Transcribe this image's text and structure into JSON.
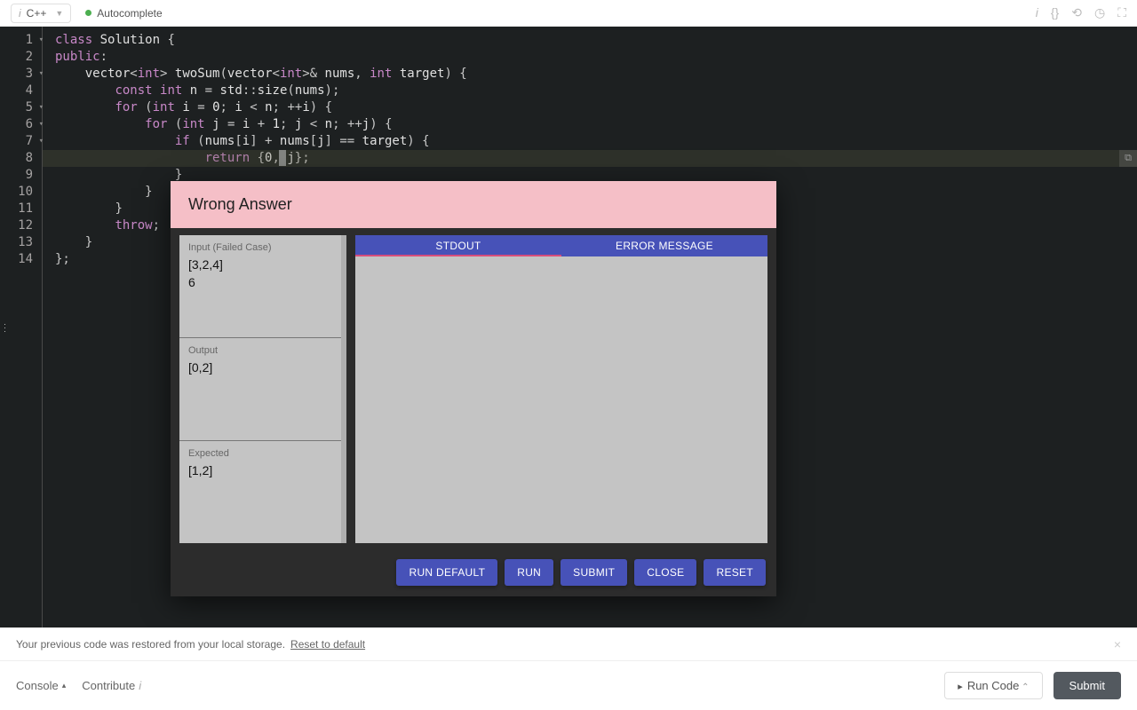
{
  "toolbar": {
    "language": "C++",
    "autocomplete": "Autocomplete"
  },
  "code_lines": [
    "class Solution {",
    "public:",
    "    vector<int> twoSum(vector<int>& nums, int target) {",
    "        const int n = std::size(nums);",
    "        for (int i = 0; i < n; ++i) {",
    "            for (int j = i + 1; j < n; ++j) {",
    "                if (nums[i] + nums[j] == target) {",
    "                    return {0, j};",
    "                }",
    "            }",
    "        }",
    "        throw;",
    "    }",
    "};"
  ],
  "modal": {
    "title": "Wrong Answer",
    "panels": {
      "input_label": "Input (Failed Case)",
      "input_value": "[3,2,4]\n6",
      "output_label": "Output",
      "output_value": "[0,2]",
      "expected_label": "Expected",
      "expected_value": "[1,2]"
    },
    "tabs": {
      "stdout": "STDOUT",
      "error": "ERROR MESSAGE"
    },
    "buttons": {
      "run_default": "RUN DEFAULT",
      "run": "RUN",
      "submit": "SUBMIT",
      "close": "CLOSE",
      "reset": "RESET"
    }
  },
  "notice": {
    "text": "Your previous code was restored from your local storage.",
    "link": "Reset to default"
  },
  "bottom": {
    "console": "Console",
    "contribute": "Contribute",
    "runcode": "Run Code",
    "submit": "Submit"
  }
}
